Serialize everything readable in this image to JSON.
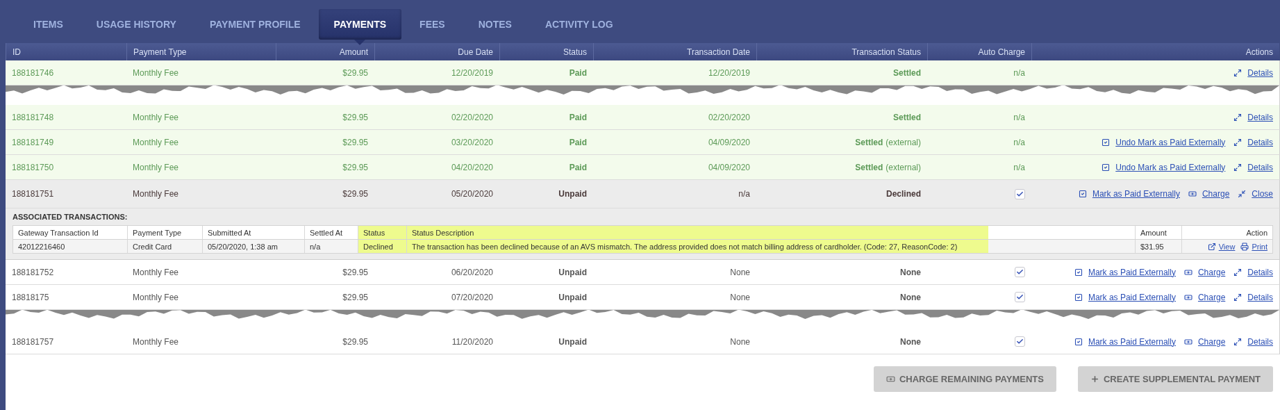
{
  "tabs": [
    {
      "label": "ITEMS",
      "selected": false
    },
    {
      "label": "USAGE HISTORY",
      "selected": false
    },
    {
      "label": "PAYMENT PROFILE",
      "selected": false
    },
    {
      "label": "PAYMENTS",
      "selected": true
    },
    {
      "label": "FEES",
      "selected": false
    },
    {
      "label": "NOTES",
      "selected": false
    },
    {
      "label": "ACTIVITY LOG",
      "selected": false
    }
  ],
  "table": {
    "columns": [
      "ID",
      "Payment Type",
      "Amount",
      "Due Date",
      "Status",
      "Transaction Date",
      "Transaction Status",
      "Auto Charge",
      "Actions"
    ],
    "rows": [
      {
        "kind": "payment",
        "id": "188181746",
        "payment_type": "Monthly Fee",
        "amount": "$29.95",
        "due_date": "12/20/2019",
        "status": "Paid",
        "transaction_date": "12/20/2019",
        "transaction_status": "Settled",
        "paid": true,
        "expanded": false,
        "auto_charge": {
          "kind": "text",
          "text": "n/a"
        },
        "actions": [
          {
            "kind": "details",
            "label": "Details"
          }
        ]
      },
      {
        "kind": "tear"
      },
      {
        "kind": "payment",
        "id": "188181748",
        "payment_type": "Monthly Fee",
        "amount": "$29.95",
        "due_date": "02/20/2020",
        "status": "Paid",
        "transaction_date": "02/20/2020",
        "transaction_status": "Settled",
        "paid": true,
        "expanded": false,
        "auto_charge": {
          "kind": "text",
          "text": "n/a"
        },
        "actions": [
          {
            "kind": "details",
            "label": "Details"
          }
        ]
      },
      {
        "kind": "payment",
        "id": "188181749",
        "payment_type": "Monthly Fee",
        "amount": "$29.95",
        "due_date": "03/20/2020",
        "status": "Paid",
        "transaction_date": "04/09/2020",
        "transaction_status": "Settled",
        "transaction_note": "(external)",
        "paid": true,
        "expanded": false,
        "auto_charge": {
          "kind": "text",
          "text": "n/a"
        },
        "actions": [
          {
            "kind": "unmark",
            "label": "Undo Mark as Paid Externally"
          },
          {
            "kind": "details",
            "label": "Details"
          }
        ]
      },
      {
        "kind": "payment",
        "id": "188181750",
        "payment_type": "Monthly Fee",
        "amount": "$29.95",
        "due_date": "04/20/2020",
        "status": "Paid",
        "transaction_date": "04/09/2020",
        "transaction_status": "Settled",
        "transaction_note": "(external)",
        "paid": true,
        "expanded": false,
        "auto_charge": {
          "kind": "text",
          "text": "n/a"
        },
        "actions": [
          {
            "kind": "unmark",
            "label": "Undo Mark as Paid Externally"
          },
          {
            "kind": "details",
            "label": "Details"
          }
        ]
      },
      {
        "kind": "payment",
        "id": "188181751",
        "payment_type": "Monthly Fee",
        "amount": "$29.95",
        "due_date": "05/20/2020",
        "status": "Unpaid",
        "transaction_date": "n/a",
        "transaction_status": "Declined",
        "paid": false,
        "expanded": true,
        "auto_charge": {
          "kind": "checkbox",
          "checked": true
        },
        "actions": [
          {
            "kind": "mark",
            "label": "Mark as Paid Externally"
          },
          {
            "kind": "charge",
            "label": "Charge"
          },
          {
            "kind": "close",
            "label": "Close"
          }
        ],
        "details": {
          "heading": "ASSOCIATED TRANSACTIONS:",
          "columns": [
            {
              "label": "Gateway Transaction Id",
              "highlighted": false
            },
            {
              "label": "Payment Type",
              "highlighted": false
            },
            {
              "label": "Submitted At",
              "highlighted": false
            },
            {
              "label": "Settled At",
              "highlighted": false
            },
            {
              "label": "Status",
              "highlighted": true
            },
            {
              "label": "Status Description",
              "highlighted": true
            },
            {
              "highlighted": false
            },
            {
              "label": "Amount",
              "highlighted": false
            },
            {
              "label": "Action",
              "highlighted": false
            }
          ],
          "rows": [
            {
              "cells": [
                "42012216460",
                "Credit Card",
                "05/20/2020, 1:38 am",
                "n/a",
                "Declined",
                "The transaction has been declined because of an AVS mismatch. The address provided does not match billing address of cardholder. (Code: 27, ReasonCode: 2)",
                "",
                "$31.95"
              ],
              "actions": [
                {
                  "kind": "view",
                  "label": "View"
                },
                {
                  "kind": "print",
                  "label": "Print"
                }
              ]
            }
          ]
        }
      },
      {
        "kind": "payment",
        "id": "188181752",
        "payment_type": "Monthly Fee",
        "amount": "$29.95",
        "due_date": "06/20/2020",
        "status": "Unpaid",
        "transaction_date": "None",
        "transaction_status": "None",
        "paid": false,
        "expanded": false,
        "auto_charge": {
          "kind": "checkbox",
          "checked": true
        },
        "actions": [
          {
            "kind": "mark",
            "label": "Mark as Paid Externally"
          },
          {
            "kind": "charge",
            "label": "Charge"
          },
          {
            "kind": "details",
            "label": "Details"
          }
        ]
      },
      {
        "kind": "payment",
        "id": "18818175",
        "payment_type": "Monthly Fee",
        "amount": "$29.95",
        "due_date": "07/20/2020",
        "status": "Unpaid",
        "transaction_date": "None",
        "transaction_status": "None",
        "paid": false,
        "expanded": false,
        "auto_charge": {
          "kind": "checkbox",
          "checked": true
        },
        "actions": [
          {
            "kind": "mark",
            "label": "Mark as Paid Externally"
          },
          {
            "kind": "charge",
            "label": "Charge"
          },
          {
            "kind": "details",
            "label": "Details"
          }
        ]
      },
      {
        "kind": "tear"
      },
      {
        "kind": "payment",
        "id": "188181757",
        "payment_type": "Monthly Fee",
        "amount": "$29.95",
        "due_date": "11/20/2020",
        "status": "Unpaid",
        "transaction_date": "None",
        "transaction_status": "None",
        "paid": false,
        "expanded": false,
        "auto_charge": {
          "kind": "checkbox",
          "checked": true
        },
        "actions": [
          {
            "kind": "mark",
            "label": "Mark as Paid Externally"
          },
          {
            "kind": "charge",
            "label": "Charge"
          },
          {
            "kind": "details",
            "label": "Details"
          }
        ]
      }
    ]
  },
  "buttons": [
    {
      "kind": "charge",
      "label": "CHARGE REMAINING PAYMENTS"
    },
    {
      "kind": "create",
      "label": "CREATE SUPPLEMENTAL PAYMENT"
    }
  ]
}
